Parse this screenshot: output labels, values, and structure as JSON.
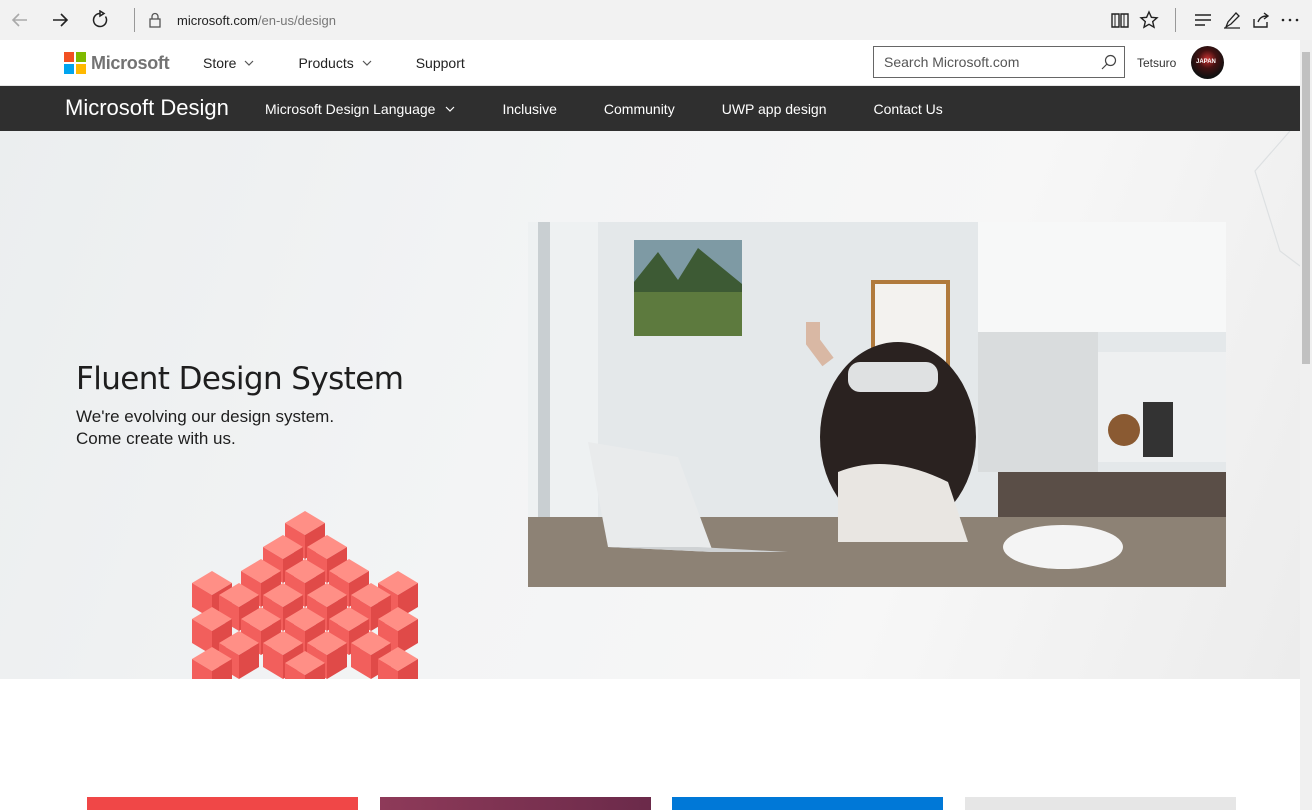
{
  "browser": {
    "url_domain": "microsoft.com",
    "url_path": "/en-us/design"
  },
  "header": {
    "logo_text": "Microsoft",
    "nav": [
      {
        "label": "Store",
        "has_dropdown": true
      },
      {
        "label": "Products",
        "has_dropdown": true
      },
      {
        "label": "Support",
        "has_dropdown": false
      }
    ],
    "search_placeholder": "Search Microsoft.com",
    "user_name": "Tetsuro",
    "avatar_text": "JAPAN"
  },
  "design_nav": {
    "title": "Microsoft Design",
    "items": [
      {
        "label": "Microsoft Design Language",
        "has_dropdown": true
      },
      {
        "label": "Inclusive",
        "has_dropdown": false
      },
      {
        "label": "Community",
        "has_dropdown": false
      },
      {
        "label": "UWP app design",
        "has_dropdown": false
      },
      {
        "label": "Contact Us",
        "has_dropdown": false
      }
    ]
  },
  "hero": {
    "title": "Fluent Design System",
    "subtitle_line1": "We're evolving our design system.",
    "subtitle_line2": "Come create with us.",
    "accent_color": "#f25f5c"
  },
  "cards": [
    {
      "color": "#f04747"
    },
    {
      "color": "#8e3a59"
    },
    {
      "color": "#0078d7"
    },
    {
      "color": "#e6e6e6"
    }
  ]
}
